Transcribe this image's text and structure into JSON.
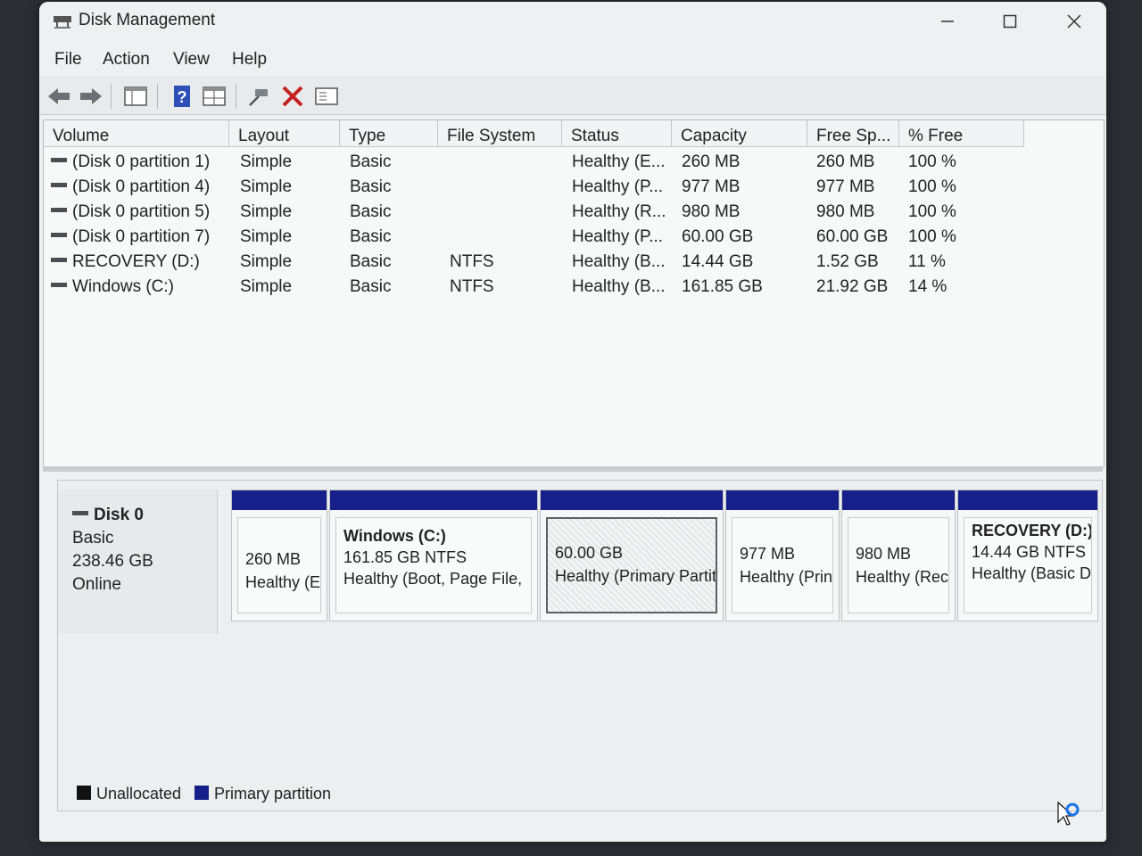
{
  "window": {
    "title": "Disk Management"
  },
  "menu": [
    "File",
    "Action",
    "View",
    "Help"
  ],
  "toolbar": [
    "back-icon",
    "forward-icon",
    "console-tree-icon",
    "help-icon",
    "properties-icon",
    "connect-icon",
    "delete-icon",
    "view-icon"
  ],
  "volumes": {
    "headers": [
      "Volume",
      "Layout",
      "Type",
      "File System",
      "Status",
      "Capacity",
      "Free Sp...",
      "% Free"
    ],
    "rows": [
      [
        "(Disk 0 partition 1)",
        "Simple",
        "Basic",
        "",
        "Healthy (E...",
        "260 MB",
        "260 MB",
        "100 %"
      ],
      [
        "(Disk 0 partition 4)",
        "Simple",
        "Basic",
        "",
        "Healthy (P...",
        "977 MB",
        "977 MB",
        "100 %"
      ],
      [
        "(Disk 0 partition 5)",
        "Simple",
        "Basic",
        "",
        "Healthy (R...",
        "980 MB",
        "980 MB",
        "100 %"
      ],
      [
        "(Disk 0 partition 7)",
        "Simple",
        "Basic",
        "",
        "Healthy (P...",
        "60.00 GB",
        "60.00 GB",
        "100 %"
      ],
      [
        "RECOVERY (D:)",
        "Simple",
        "Basic",
        "NTFS",
        "Healthy (B...",
        "14.44 GB",
        "1.52 GB",
        "11 %"
      ],
      [
        "Windows (C:)",
        "Simple",
        "Basic",
        "NTFS",
        "Healthy (B...",
        "161.85 GB",
        "21.92 GB",
        "14 %"
      ]
    ]
  },
  "disk": {
    "name": "Disk 0",
    "type": "Basic",
    "size": "238.46 GB",
    "state": "Online",
    "partitions": [
      {
        "title": "",
        "size": "260 MB",
        "status": "Healthy (E"
      },
      {
        "title": "Windows  (C:)",
        "size": "161.85 GB NTFS",
        "status": "Healthy (Boot, Page File,"
      },
      {
        "title": "",
        "size": "60.00 GB",
        "status": "Healthy (Primary Partit",
        "selected": true
      },
      {
        "title": "",
        "size": "977 MB",
        "status": "Healthy (Prin"
      },
      {
        "title": "",
        "size": "980 MB",
        "status": "Healthy (Rec"
      },
      {
        "title": "RECOVERY  (D:)",
        "size": "14.44 GB NTFS",
        "status": "Healthy (Basic Data"
      }
    ]
  },
  "legend": [
    {
      "label": "Unallocated",
      "color": "#111111"
    },
    {
      "label": "Primary partition",
      "color": "#16208a"
    }
  ],
  "colors": {
    "primary_partition": "#16208a",
    "window_bg": "#eef0f1"
  }
}
